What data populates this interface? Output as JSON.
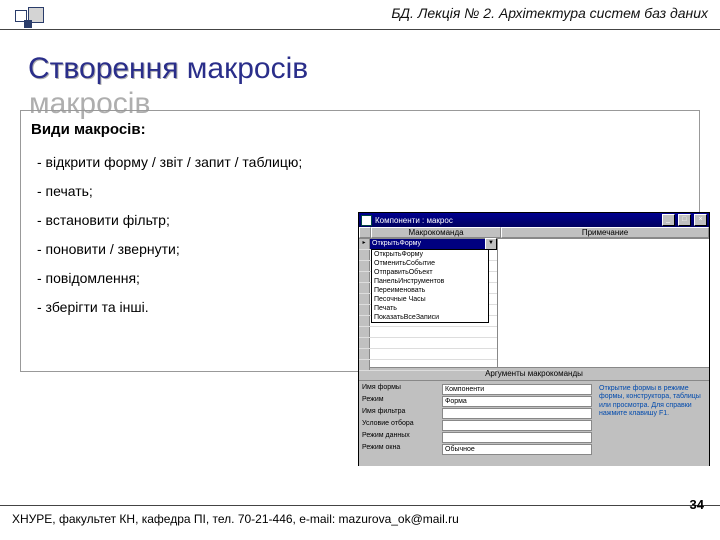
{
  "header": {
    "text": "БД. Лекція № 2. Архітектура систем баз даних"
  },
  "title": "Створення макросів",
  "body": {
    "subhead": "Види макросів:",
    "items": [
      "- відкрити форму / звіт / запит / таблицю;",
      "- печать;",
      "- встановити фільтр;",
      "- поновити / звернути;",
      "- повідомлення;",
      "- зберігти та інші."
    ]
  },
  "screenshot": {
    "window_title": "Компоненти : макрос",
    "btn_min": "_",
    "btn_max": "□",
    "btn_close": "×",
    "columns": {
      "c1": "Макрокоманда",
      "c2": "Примечание"
    },
    "selected_cell": "ОткрытьФорму",
    "dropdown_glyph": "▼",
    "dropdown_items": [
      "ОткрытьФорму",
      "ОтменитьСобытие",
      "ОтправитьОбъект",
      "ПанельИнструментов",
      "Переименовать",
      "Песочные Часы",
      "Печать",
      "ПоказатьВсеЗаписи"
    ],
    "args_header": "Аргументы макрокоманды",
    "args_rows": [
      {
        "label": "Имя формы",
        "value": "Компоненти"
      },
      {
        "label": "Режим",
        "value": "Форма"
      },
      {
        "label": "Имя фильтра",
        "value": ""
      },
      {
        "label": "Условие отбора",
        "value": ""
      },
      {
        "label": "Режим данных",
        "value": ""
      },
      {
        "label": "Режим окна",
        "value": "Обычное"
      }
    ],
    "help_text": "Открытие формы в режиме формы, конструктора, таблицы или просмотра. Для справки нажмите клавишу F1."
  },
  "footer": {
    "text": "ХНУРЕ, факультет КН, кафедра ПІ, тел. 70-21-446, e-mail: mazurova_ok@mail.ru",
    "page": "34"
  }
}
